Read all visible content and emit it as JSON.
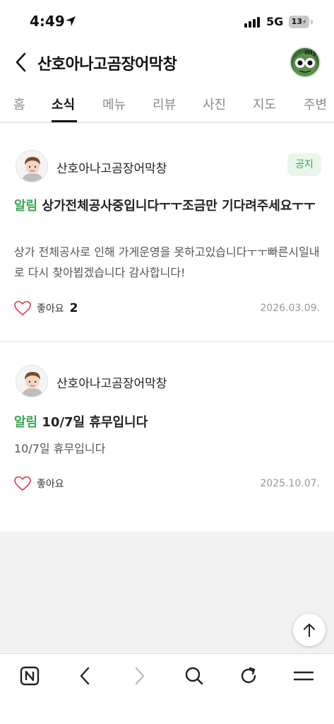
{
  "status_bar": {
    "time": "4:49",
    "network": "5G",
    "battery": "13"
  },
  "header": {
    "title": "산호아나고곰장어막창",
    "avatar_badge": "my"
  },
  "tabs": [
    {
      "label": "홈",
      "active": false
    },
    {
      "label": "소식",
      "active": true
    },
    {
      "label": "메뉴",
      "active": false
    },
    {
      "label": "리뷰",
      "active": false
    },
    {
      "label": "사진",
      "active": false
    },
    {
      "label": "지도",
      "active": false
    },
    {
      "label": "주변",
      "active": false
    }
  ],
  "posts": [
    {
      "author": "산호아나고곰장어막창",
      "badge": "공지",
      "tag": "알림",
      "title": "상가전체공사중입니다ㅜㅜ조금만 기다려주세요ㅜㅜ",
      "body": "상가 전체공사로 인해 가게운영을 못하고있습니다ㅜㅜ빠른시일내로 다시 찾아뵙겠습니다 감사합니다!",
      "like_label": "좋아요",
      "like_count": "2",
      "date": "2026.03.09."
    },
    {
      "author": "산호아나고곰장어막창",
      "badge": "",
      "tag": "알림",
      "title": "10/7일 휴무입니다",
      "body": "10/7일 휴무입니다",
      "like_label": "좋아요",
      "like_count": "",
      "date": "2025.10.07."
    }
  ],
  "colors": {
    "accent_green": "#3aa653",
    "badge_bg": "#e9f6ec",
    "like_heart": "#e0354b"
  },
  "toolbar": {
    "icons": [
      "naver-home-icon",
      "back-icon",
      "forward-icon",
      "search-icon",
      "refresh-icon",
      "menu-icon"
    ]
  }
}
